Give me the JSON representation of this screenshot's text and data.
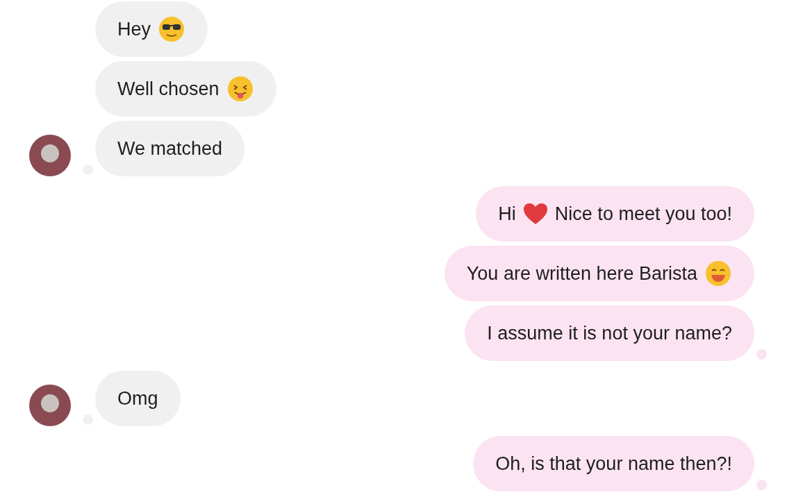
{
  "groups": [
    {
      "kind": "incoming",
      "messages": [
        {
          "parts": [
            {
              "kind": "text",
              "text": "Hey"
            },
            {
              "kind": "sunglasses"
            }
          ]
        },
        {
          "parts": [
            {
              "kind": "text",
              "text": "Well chosen"
            },
            {
              "kind": "tongue"
            }
          ]
        },
        {
          "parts": [
            {
              "kind": "text",
              "text": "We matched"
            }
          ]
        }
      ]
    },
    {
      "kind": "outgoing",
      "messages": [
        {
          "parts": [
            {
              "kind": "text",
              "text": "Hi"
            },
            {
              "kind": "heart"
            },
            {
              "kind": "text",
              "text": "Nice to meet you too!"
            }
          ]
        },
        {
          "parts": [
            {
              "kind": "text",
              "text": "You are written here Barista"
            },
            {
              "kind": "grin"
            }
          ]
        },
        {
          "parts": [
            {
              "kind": "text",
              "text": "I assume it is not your name?"
            }
          ]
        }
      ]
    },
    {
      "kind": "incoming",
      "messages": [
        {
          "parts": [
            {
              "kind": "text",
              "text": "Omg"
            }
          ]
        }
      ]
    },
    {
      "kind": "outgoing",
      "messages": [
        {
          "parts": [
            {
              "kind": "text",
              "text": "Oh, is that your name then?!"
            }
          ]
        }
      ]
    }
  ]
}
